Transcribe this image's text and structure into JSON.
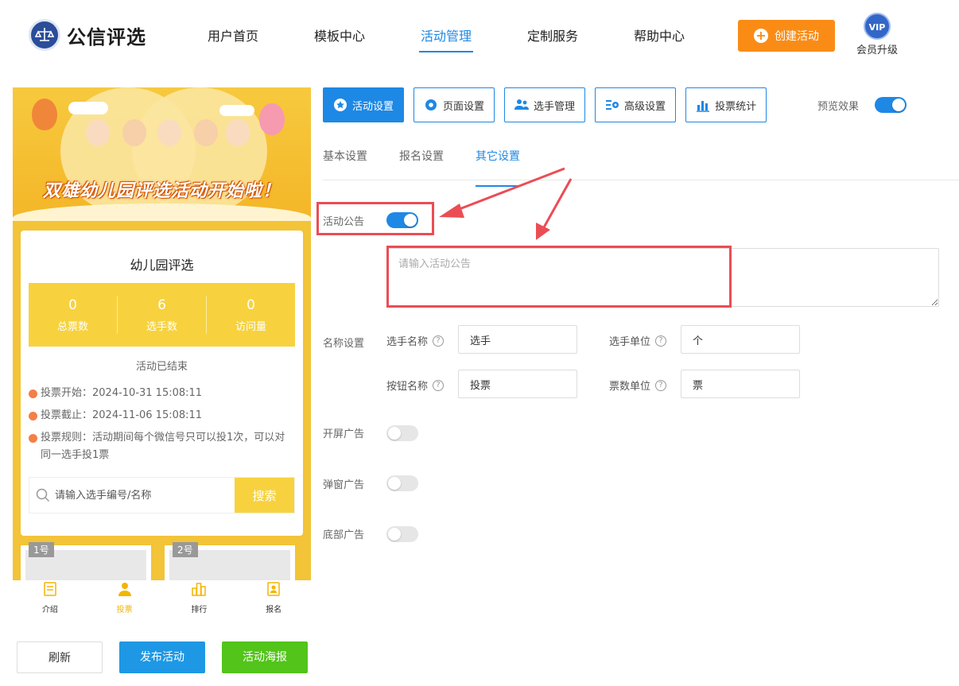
{
  "header": {
    "brand": "公信评选",
    "nav": [
      "用户首页",
      "模板中心",
      "活动管理",
      "定制服务",
      "帮助中心"
    ],
    "active_nav": "活动管理",
    "create_button": "创建活动",
    "vip_badge": "VIP",
    "vip_label": "会员升级"
  },
  "preview": {
    "banner_title": "双雄幼儿园评选活动开始啦！",
    "card_title": "幼儿园评选",
    "stats": [
      {
        "value": "0",
        "label": "总票数"
      },
      {
        "value": "6",
        "label": "选手数"
      },
      {
        "value": "0",
        "label": "访问量"
      }
    ],
    "status": "活动已结束",
    "vote_start": "投票开始：2024-10-31 15:08:11",
    "vote_end": "投票截止：2024-11-06 15:08:11",
    "vote_rule": "投票规则：活动期间每个微信号只可以投1次，可以对同一选手投1票",
    "search_placeholder": "请输入选手编号/名称",
    "search_button": "搜索",
    "players": [
      "1号",
      "2号"
    ],
    "tabs": [
      "介绍",
      "投票",
      "排行",
      "报名"
    ],
    "active_tab": "投票"
  },
  "actions": {
    "refresh": "刷新",
    "publish": "发布活动",
    "poster": "活动海报"
  },
  "settings": {
    "toolbar": [
      "活动设置",
      "页面设置",
      "选手管理",
      "高级设置",
      "投票统计"
    ],
    "preview_label": "预览效果",
    "preview_on": true,
    "subtabs": [
      "基本设置",
      "报名设置",
      "其它设置"
    ],
    "active_subtab": "其它设置",
    "announcement_label": "活动公告",
    "announcement_on": true,
    "announcement_placeholder": "请输入活动公告",
    "naming_label": "名称设置",
    "player_name_label": "选手名称",
    "player_name_value": "选手",
    "player_unit_label": "选手单位",
    "player_unit_value": "个",
    "button_name_label": "按钮名称",
    "button_name_value": "投票",
    "vote_unit_label": "票数单位",
    "vote_unit_value": "票",
    "splash_ad_label": "开屏广告",
    "popup_ad_label": "弹窗广告",
    "bottom_ad_label": "底部广告",
    "help_glyph": "?"
  },
  "colors": {
    "primary": "#1e88e5",
    "orange": "#fa8c16",
    "yellow": "#f7d23e",
    "green": "#52c41a",
    "annotation": "#eb4d55"
  }
}
